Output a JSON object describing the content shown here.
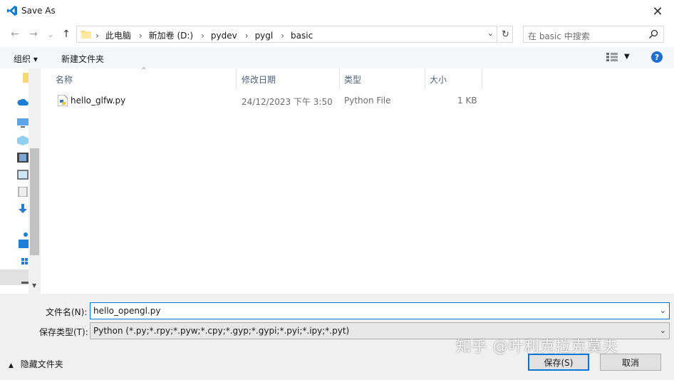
{
  "window": {
    "title": "Save As",
    "close_glyph": "✕"
  },
  "nav": {
    "back_glyph": "←",
    "forward_glyph": "→",
    "recent_glyph": "⌄",
    "up_glyph": "↑",
    "breadcrumbs": [
      "此电脑",
      "新加卷 (D:)",
      "pydev",
      "pygl",
      "basic"
    ],
    "separator": "›",
    "address_dropdown_glyph": "⌄",
    "refresh_glyph": "↻",
    "search_placeholder": "在 basic 中搜索"
  },
  "toolbar": {
    "organize_label": "组织 ▾",
    "new_folder_label": "新建文件夹",
    "view_dropdown_glyph": "▼",
    "help_label": "?"
  },
  "columns": {
    "name": "名称",
    "modified": "修改日期",
    "type": "类型",
    "size": "大小",
    "sort_glyph": "^"
  },
  "files": [
    {
      "name": "hello_glfw.py",
      "modified": "24/12/2023 下午 3:50",
      "type": "Python File",
      "size": "1 KB"
    }
  ],
  "form": {
    "filename_label": "文件名(N):",
    "filename_value": "hello_opengl.py",
    "filetype_label": "保存类型(T):",
    "filetype_value": "Python (*.py;*.rpy;*.pyw;*.cpy;*.gyp;*.gypi;*.pyi;*.ipy;*.pyt)",
    "dropdown_glyph": "⌄"
  },
  "footer": {
    "hide_folders_label": "隐藏文件夹",
    "hide_folders_glyph": "▲",
    "save_label": "保存(S)",
    "cancel_label": "取消"
  },
  "watermark": "知乎 @叶利克拉克莫夫",
  "colors": {
    "accent": "#0078d7",
    "help_blue": "#1e6ecf",
    "toolbar_bg": "#f5f6f7",
    "footer_bg": "#f0f0f0"
  }
}
